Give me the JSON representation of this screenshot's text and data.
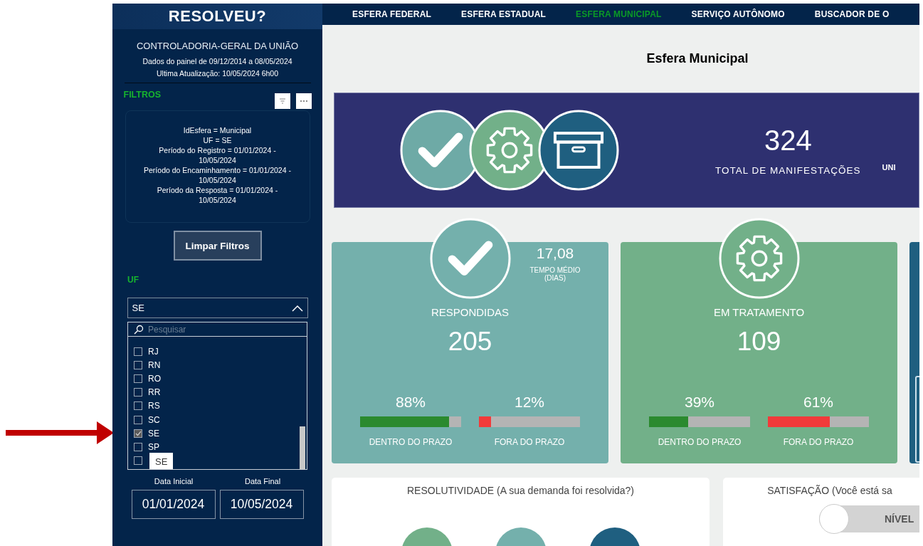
{
  "sidebar": {
    "title": "RESOLVEU?",
    "subtitle": "CONTROLADORIA-GERAL DA UNIÃO",
    "info": [
      "Dados do painel de 09/12/2014 a 08/05/2024",
      "Ultima Atualização: 10/05/2024 6h00"
    ],
    "filters_label": "FILTROS",
    "filter_summary": [
      "IdEsfera = Municipal",
      "UF = SE",
      "Período do Registro = 01/01/2024 - 10/05/2024",
      "Período do Encaminhamento = 01/01/2024 - 10/05/2024",
      "Período da Resposta = 01/01/2024 - 10/05/2024"
    ],
    "clear_button": "Limpar Filtros",
    "uf_label": "UF",
    "uf_dropdown": {
      "value": "SE",
      "search_placeholder": "Pesquisar",
      "tooltip": "SE",
      "options": [
        {
          "label": "RJ",
          "checked": false
        },
        {
          "label": "RN",
          "checked": false
        },
        {
          "label": "RO",
          "checked": false
        },
        {
          "label": "RR",
          "checked": false
        },
        {
          "label": "RS",
          "checked": false
        },
        {
          "label": "SC",
          "checked": false
        },
        {
          "label": "SE",
          "checked": true
        },
        {
          "label": "SP",
          "checked": false
        },
        {
          "checked": false
        }
      ]
    },
    "date_labels": [
      "Data Inicial",
      "Data Final"
    ],
    "dates": [
      "01/01/2024",
      "10/05/2024"
    ]
  },
  "tabs": [
    {
      "label": "ESFERA FEDERAL",
      "selected": false
    },
    {
      "label": "ESFERA ESTADUAL",
      "selected": false
    },
    {
      "label": "ESFERA  MUNICIPAL",
      "selected": true
    },
    {
      "label": "SERVIÇO AUTÔNOMO",
      "selected": false
    },
    {
      "label": "BUSCADOR DE O",
      "selected": false
    }
  ],
  "page_title": "Esfera Municipal",
  "summary": {
    "total": "324",
    "total_label": "TOTAL DE MANIFESTAÇÕES",
    "next_label": "UNI"
  },
  "cards": [
    {
      "kind": "check",
      "color": "#74b0ac",
      "title": "RESPONDIDAS",
      "value": "205",
      "time_value": "17,08",
      "time_label": "TEMPO MÉDIO (DIAS)",
      "bars": [
        {
          "pct": "88%",
          "level": 0.88,
          "label": "DENTRO DO PRAZO"
        },
        {
          "pct": "12%",
          "level": 0.12,
          "label": "FORA DO PRAZO"
        }
      ]
    },
    {
      "kind": "gear",
      "color": "#72b089",
      "title": "EM TRATAMENTO",
      "value": "109",
      "bars": [
        {
          "pct": "39%",
          "level": 0.39,
          "label": "DENTRO DO PRAZO"
        },
        {
          "pct": "61%",
          "level": 0.61,
          "label": "FORA DO PRAZO"
        }
      ]
    },
    {
      "kind": "partial",
      "color": "#1f5f80"
    }
  ],
  "panels": [
    {
      "title": "RESOLUTIVIDADE (A sua demanda foi resolvida?)"
    },
    {
      "title": "SATISFAÇÃO (Você está sa",
      "pill_label": "NÍVEL"
    }
  ]
}
